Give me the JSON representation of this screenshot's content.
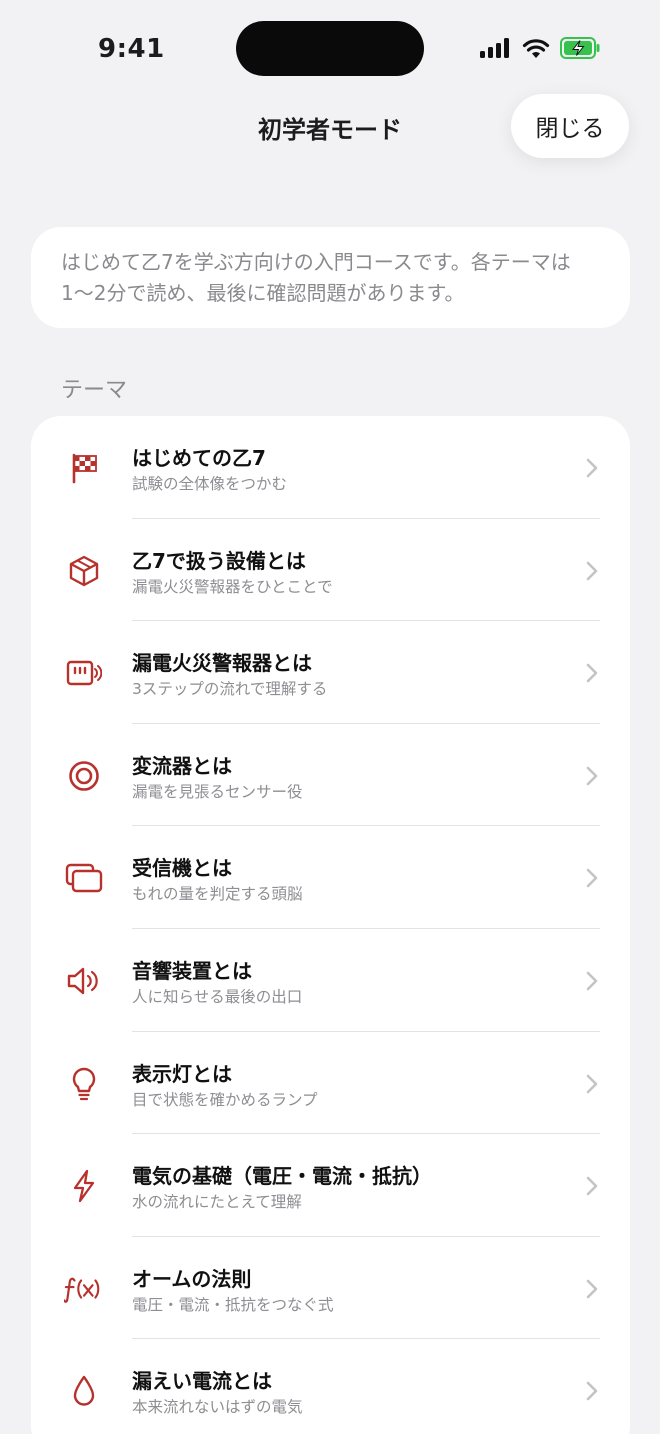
{
  "status_bar": {
    "time": "9:41"
  },
  "nav": {
    "title": "初学者モード",
    "close_label": "閉じる"
  },
  "intro": {
    "text": "はじめて乙7を学ぶ方向けの入門コースです。各テーマは1〜2分で読め、最後に確認問題があります。"
  },
  "section": {
    "label": "テーマ"
  },
  "accent_color": "#b8322d",
  "topics": [
    {
      "icon": "checkered-flag-icon",
      "title": "はじめての乙7",
      "subtitle": "試験の全体像をつかむ"
    },
    {
      "icon": "cube-icon",
      "title": "乙7で扱う設備とは",
      "subtitle": "漏電火災警報器をひとことで"
    },
    {
      "icon": "alarm-panel-icon",
      "title": "漏電火災警報器とは",
      "subtitle": "3ステップの流れで理解する"
    },
    {
      "icon": "target-circle-icon",
      "title": "変流器とは",
      "subtitle": "漏電を見張るセンサー役"
    },
    {
      "icon": "stacked-windows-icon",
      "title": "受信機とは",
      "subtitle": "もれの量を判定する頭脳"
    },
    {
      "icon": "speaker-icon",
      "title": "音響装置とは",
      "subtitle": "人に知らせる最後の出口"
    },
    {
      "icon": "lightbulb-icon",
      "title": "表示灯とは",
      "subtitle": "目で状態を確かめるランプ"
    },
    {
      "icon": "lightning-bolt-icon",
      "title": "電気の基礎（電圧・電流・抵抗）",
      "subtitle": "水の流れにたとえて理解"
    },
    {
      "icon": "function-fx-icon",
      "title": "オームの法則",
      "subtitle": "電圧・電流・抵抗をつなぐ式"
    },
    {
      "icon": "water-drop-icon",
      "title": "漏えい電流とは",
      "subtitle": "本来流れないはずの電気"
    }
  ]
}
